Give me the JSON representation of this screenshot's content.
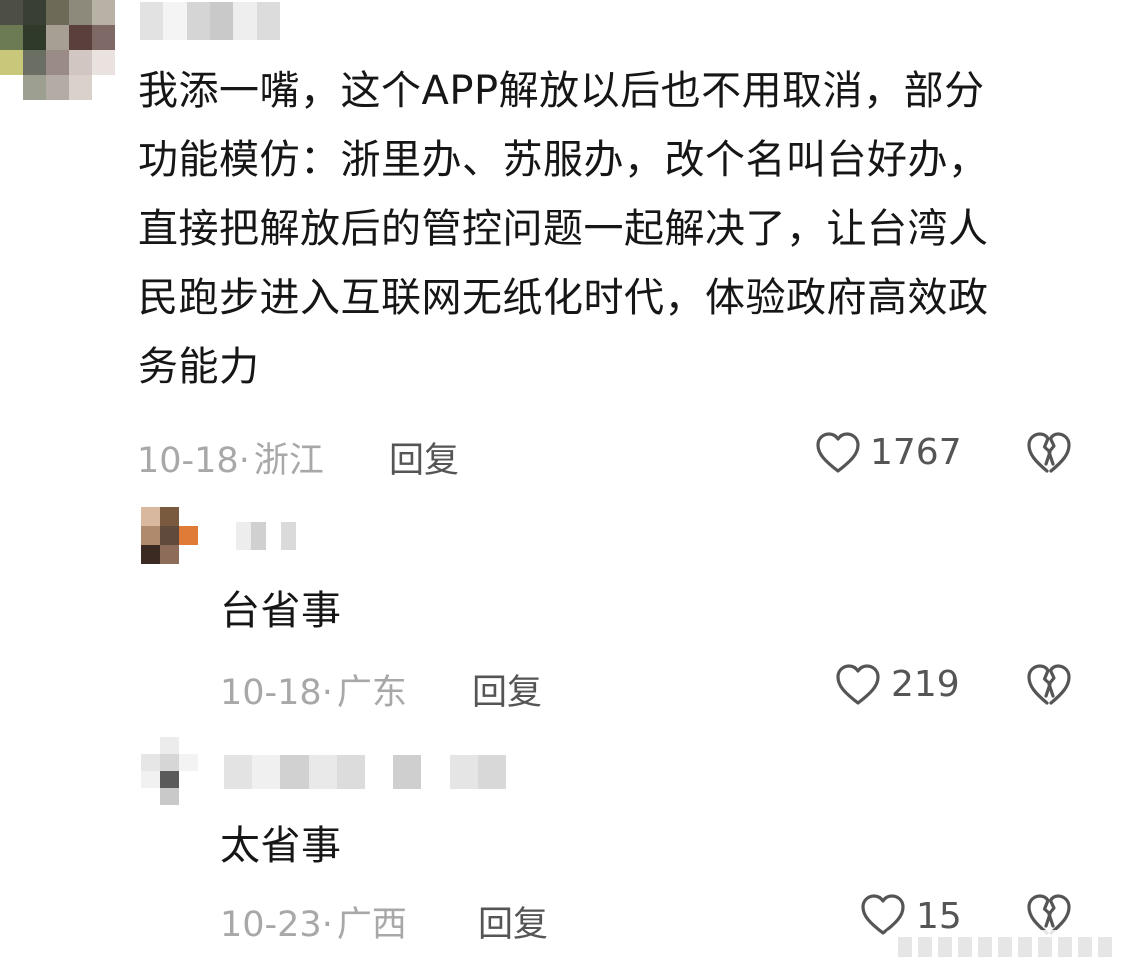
{
  "comments": [
    {
      "text_lines": [
        "我添一嘴，这个APP解放以后也不用取消，部分",
        "功能模仿：浙里办、苏服办，改个名叫台好办，",
        "直接把解放后的管控问题一起解决了，让台湾人",
        "民跑步进入互联网无纸化时代，体验政府高效政",
        "务能力"
      ],
      "date": "10-18",
      "separator": "·",
      "location": "浙江",
      "reply_label": "回复",
      "likes": "1767"
    },
    {
      "text": "台省事",
      "date": "10-18",
      "separator": "·",
      "location": "广东",
      "reply_label": "回复",
      "likes": "219"
    },
    {
      "text": "太省事",
      "date": "10-23",
      "separator": "·",
      "location": "广西",
      "reply_label": "回复",
      "likes": "15"
    }
  ],
  "icons": {
    "like": "heart-outline-icon",
    "dislike": "broken-heart-icon"
  },
  "colors": {
    "text": "#161616",
    "meta": "#a8a8a8",
    "action": "#555555"
  }
}
